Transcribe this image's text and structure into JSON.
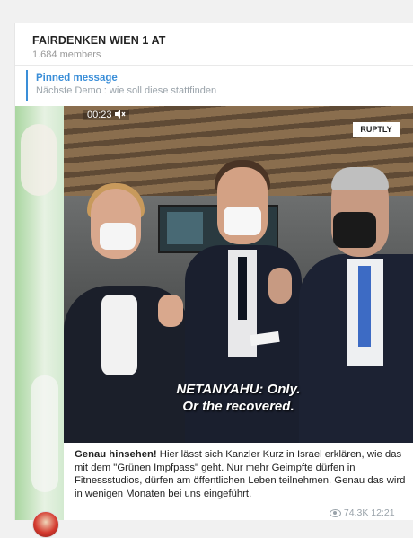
{
  "chat": {
    "title": "FAIRDENKEN WIEN 1 AT",
    "members": "1.684 members"
  },
  "pinned": {
    "label": "Pinned message",
    "text": "Nächste Demo : wie soll diese stattfinden"
  },
  "video": {
    "timer": "00:23",
    "logo": "RUPTLY",
    "subtitle_line1": "NETANYAHU: Only.",
    "subtitle_line2": "Or the recovered."
  },
  "message": {
    "caption_bold": "Genau hinsehen!",
    "caption_rest": " Hier lässt sich Kanzler Kurz in Israel erklären, wie das mit dem \"Grünen Impfpass\" geht. Nur mehr Geimpfte dürfen in Fitnessstudios, dürfen am öffentlichen Leben teilnehmen. Genau das wird in wenigen Monaten bei uns eingeführt.",
    "views": "74.3K",
    "time": "12:21"
  },
  "colors": {
    "accent": "#3a8ed8",
    "muted": "#9aa3aa"
  },
  "icons": [
    "speaker-muted-icon",
    "eye-icon",
    "channel-avatar"
  ]
}
